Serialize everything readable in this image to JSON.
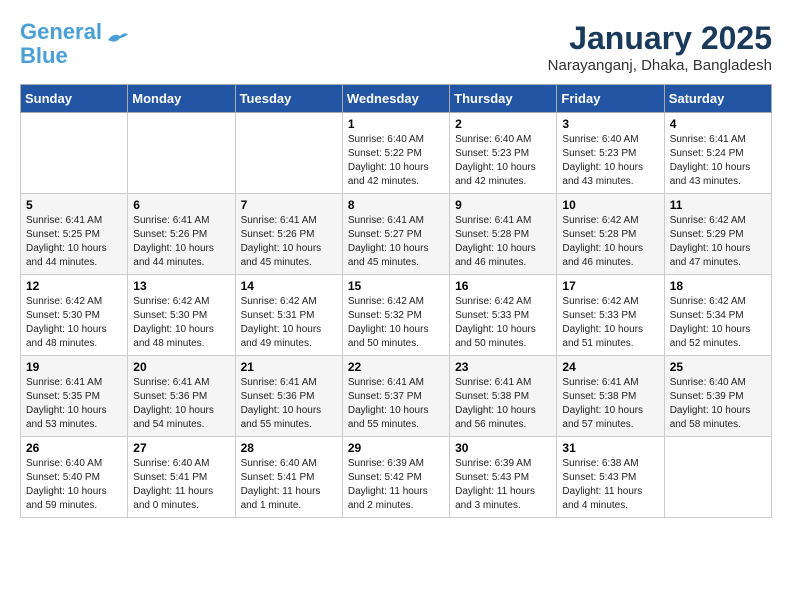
{
  "header": {
    "logo_line1": "General",
    "logo_line2": "Blue",
    "month_year": "January 2025",
    "location": "Narayanganj, Dhaka, Bangladesh"
  },
  "weekdays": [
    "Sunday",
    "Monday",
    "Tuesday",
    "Wednesday",
    "Thursday",
    "Friday",
    "Saturday"
  ],
  "weeks": [
    [
      {
        "day": "",
        "info": ""
      },
      {
        "day": "",
        "info": ""
      },
      {
        "day": "",
        "info": ""
      },
      {
        "day": "1",
        "info": "Sunrise: 6:40 AM\nSunset: 5:22 PM\nDaylight: 10 hours\nand 42 minutes."
      },
      {
        "day": "2",
        "info": "Sunrise: 6:40 AM\nSunset: 5:23 PM\nDaylight: 10 hours\nand 42 minutes."
      },
      {
        "day": "3",
        "info": "Sunrise: 6:40 AM\nSunset: 5:23 PM\nDaylight: 10 hours\nand 43 minutes."
      },
      {
        "day": "4",
        "info": "Sunrise: 6:41 AM\nSunset: 5:24 PM\nDaylight: 10 hours\nand 43 minutes."
      }
    ],
    [
      {
        "day": "5",
        "info": "Sunrise: 6:41 AM\nSunset: 5:25 PM\nDaylight: 10 hours\nand 44 minutes."
      },
      {
        "day": "6",
        "info": "Sunrise: 6:41 AM\nSunset: 5:26 PM\nDaylight: 10 hours\nand 44 minutes."
      },
      {
        "day": "7",
        "info": "Sunrise: 6:41 AM\nSunset: 5:26 PM\nDaylight: 10 hours\nand 45 minutes."
      },
      {
        "day": "8",
        "info": "Sunrise: 6:41 AM\nSunset: 5:27 PM\nDaylight: 10 hours\nand 45 minutes."
      },
      {
        "day": "9",
        "info": "Sunrise: 6:41 AM\nSunset: 5:28 PM\nDaylight: 10 hours\nand 46 minutes."
      },
      {
        "day": "10",
        "info": "Sunrise: 6:42 AM\nSunset: 5:28 PM\nDaylight: 10 hours\nand 46 minutes."
      },
      {
        "day": "11",
        "info": "Sunrise: 6:42 AM\nSunset: 5:29 PM\nDaylight: 10 hours\nand 47 minutes."
      }
    ],
    [
      {
        "day": "12",
        "info": "Sunrise: 6:42 AM\nSunset: 5:30 PM\nDaylight: 10 hours\nand 48 minutes."
      },
      {
        "day": "13",
        "info": "Sunrise: 6:42 AM\nSunset: 5:30 PM\nDaylight: 10 hours\nand 48 minutes."
      },
      {
        "day": "14",
        "info": "Sunrise: 6:42 AM\nSunset: 5:31 PM\nDaylight: 10 hours\nand 49 minutes."
      },
      {
        "day": "15",
        "info": "Sunrise: 6:42 AM\nSunset: 5:32 PM\nDaylight: 10 hours\nand 50 minutes."
      },
      {
        "day": "16",
        "info": "Sunrise: 6:42 AM\nSunset: 5:33 PM\nDaylight: 10 hours\nand 50 minutes."
      },
      {
        "day": "17",
        "info": "Sunrise: 6:42 AM\nSunset: 5:33 PM\nDaylight: 10 hours\nand 51 minutes."
      },
      {
        "day": "18",
        "info": "Sunrise: 6:42 AM\nSunset: 5:34 PM\nDaylight: 10 hours\nand 52 minutes."
      }
    ],
    [
      {
        "day": "19",
        "info": "Sunrise: 6:41 AM\nSunset: 5:35 PM\nDaylight: 10 hours\nand 53 minutes."
      },
      {
        "day": "20",
        "info": "Sunrise: 6:41 AM\nSunset: 5:36 PM\nDaylight: 10 hours\nand 54 minutes."
      },
      {
        "day": "21",
        "info": "Sunrise: 6:41 AM\nSunset: 5:36 PM\nDaylight: 10 hours\nand 55 minutes."
      },
      {
        "day": "22",
        "info": "Sunrise: 6:41 AM\nSunset: 5:37 PM\nDaylight: 10 hours\nand 55 minutes."
      },
      {
        "day": "23",
        "info": "Sunrise: 6:41 AM\nSunset: 5:38 PM\nDaylight: 10 hours\nand 56 minutes."
      },
      {
        "day": "24",
        "info": "Sunrise: 6:41 AM\nSunset: 5:38 PM\nDaylight: 10 hours\nand 57 minutes."
      },
      {
        "day": "25",
        "info": "Sunrise: 6:40 AM\nSunset: 5:39 PM\nDaylight: 10 hours\nand 58 minutes."
      }
    ],
    [
      {
        "day": "26",
        "info": "Sunrise: 6:40 AM\nSunset: 5:40 PM\nDaylight: 10 hours\nand 59 minutes."
      },
      {
        "day": "27",
        "info": "Sunrise: 6:40 AM\nSunset: 5:41 PM\nDaylight: 11 hours\nand 0 minutes."
      },
      {
        "day": "28",
        "info": "Sunrise: 6:40 AM\nSunset: 5:41 PM\nDaylight: 11 hours\nand 1 minute."
      },
      {
        "day": "29",
        "info": "Sunrise: 6:39 AM\nSunset: 5:42 PM\nDaylight: 11 hours\nand 2 minutes."
      },
      {
        "day": "30",
        "info": "Sunrise: 6:39 AM\nSunset: 5:43 PM\nDaylight: 11 hours\nand 3 minutes."
      },
      {
        "day": "31",
        "info": "Sunrise: 6:38 AM\nSunset: 5:43 PM\nDaylight: 11 hours\nand 4 minutes."
      },
      {
        "day": "",
        "info": ""
      }
    ]
  ]
}
